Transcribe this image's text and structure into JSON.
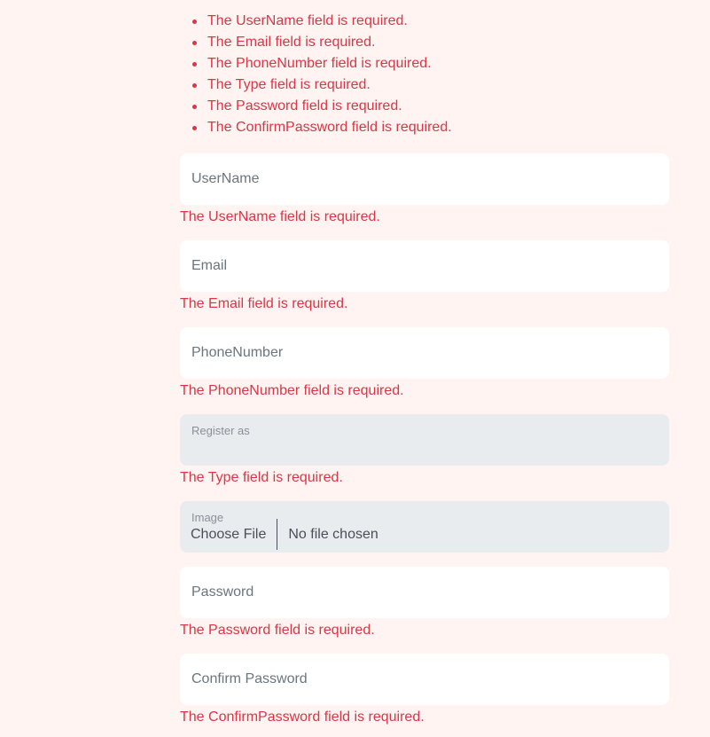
{
  "validation_summary": [
    "The UserName field is required.",
    "The Email field is required.",
    "The PhoneNumber field is required.",
    "The Type field is required.",
    "The Password field is required.",
    "The ConfirmPassword field is required."
  ],
  "fields": {
    "username": {
      "placeholder": "UserName",
      "error": "The UserName field is required."
    },
    "email": {
      "placeholder": "Email",
      "error": "The Email field is required."
    },
    "phone": {
      "placeholder": "PhoneNumber",
      "error": "The PhoneNumber field is required."
    },
    "type": {
      "label": "Register as",
      "error": "The Type field is required."
    },
    "image": {
      "label": "Image",
      "button": "Choose File",
      "status": "No file chosen"
    },
    "password": {
      "placeholder": "Password",
      "error": "The Password field is required."
    },
    "confirm": {
      "placeholder": "Confirm Password",
      "error": "The ConfirmPassword field is required."
    }
  },
  "colors": {
    "background": "#fff4f2",
    "error": "#dc3545",
    "input": "#ffffff",
    "disabled_input": "#e9ecef"
  }
}
